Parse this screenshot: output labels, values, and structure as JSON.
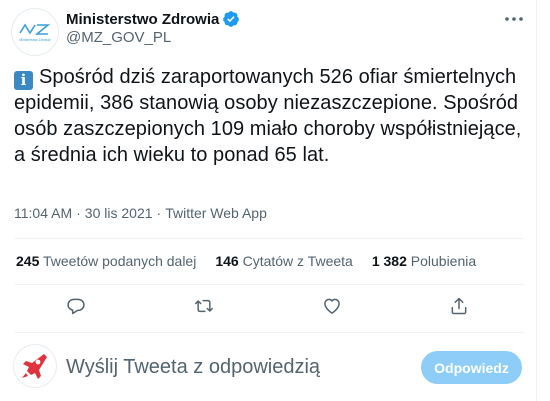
{
  "author": {
    "name": "Ministerstwo Zdrowia",
    "handle": "@MZ_GOV_PL",
    "logo_text": "Ministerstwo Zdrowia",
    "verified": true
  },
  "tweet": {
    "emoji": "i",
    "text": "Spośród dziś zaraportowanych 526 ofiar śmiertelnych epidemii, 386 stanowią osoby niezaszczepione. Spośród osób zaszczepionych 109 miało choroby współistniejące, a średnia ich wieku to ponad 65 lat.",
    "time": "11:04 AM",
    "separator": "·",
    "date": "30 lis 2021",
    "source": "Twitter Web App"
  },
  "stats": {
    "retweets_count": "245",
    "retweets_label": "Tweetów podanych dalej",
    "quotes_count": "146",
    "quotes_label": "Cytatów z Tweeta",
    "likes_count": "1 382",
    "likes_label": "Polubienia"
  },
  "reply": {
    "placeholder": "Wyślij Tweeta z odpowiedzią",
    "button_label": "Odpowiedz"
  },
  "colors": {
    "accent": "#1d9bf0",
    "reply_button": "#8ecdf8",
    "secondary_text": "#536471",
    "logo_blue": "#3aa0d8"
  },
  "icons": [
    "verified-badge-icon",
    "more-icon",
    "reply-icon",
    "retweet-icon",
    "like-icon",
    "share-icon"
  ]
}
